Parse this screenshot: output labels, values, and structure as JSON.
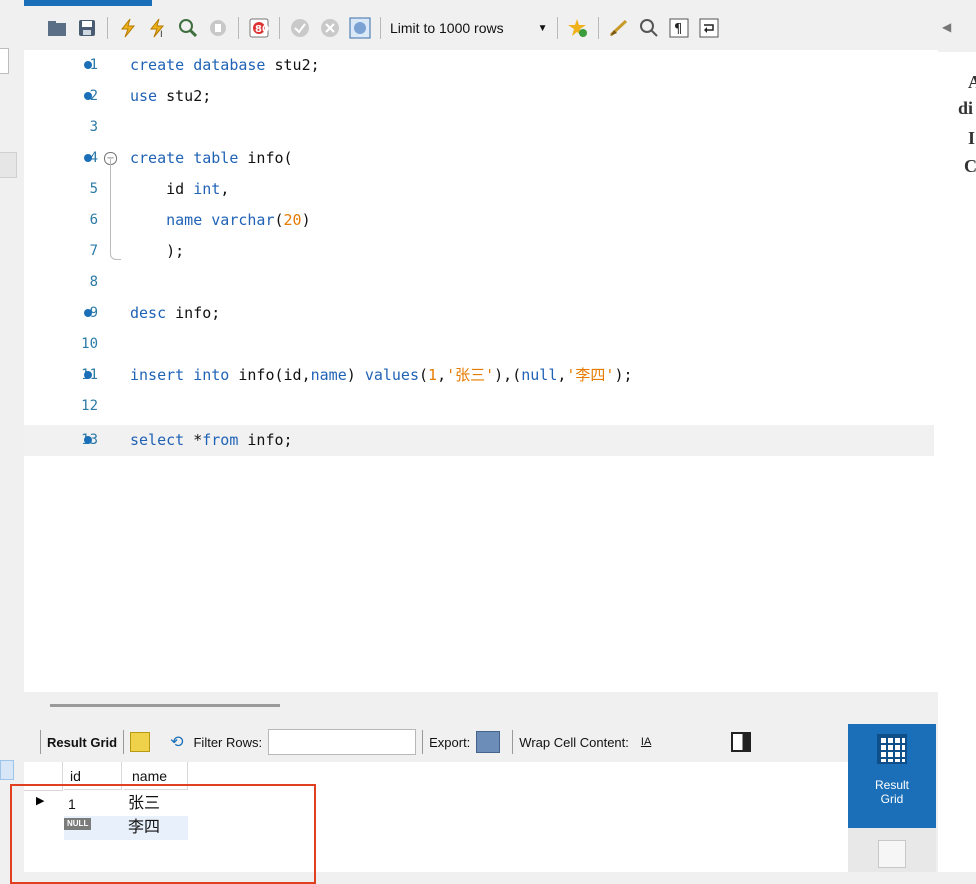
{
  "toolbar": {
    "limit_label": "Limit to 1000 rows",
    "icons": [
      "folder-open-icon",
      "save-icon",
      "execute-icon",
      "execute-current-icon",
      "explain-icon",
      "stop-icon",
      "toggle-error-icon",
      "commit-icon",
      "rollback-icon",
      "autocommit-icon",
      "add-snippet-icon",
      "beautify-icon",
      "find-icon",
      "invisible-chars-icon",
      "wrap-icon"
    ]
  },
  "editor": {
    "lines": [
      {
        "n": "1",
        "code": "create database stu2;"
      },
      {
        "n": "2",
        "code": "use stu2;"
      },
      {
        "n": "3",
        "code": ""
      },
      {
        "n": "4",
        "code": "create table info("
      },
      {
        "n": "5",
        "code": "    id int,"
      },
      {
        "n": "6",
        "code": "    name varchar(20)"
      },
      {
        "n": "7",
        "code": "    );"
      },
      {
        "n": "8",
        "code": ""
      },
      {
        "n": "9",
        "code": "desc info;"
      },
      {
        "n": "10",
        "code": ""
      },
      {
        "n": "11",
        "code": "insert into info(id,name) values(1,'张三'),(null,'李四');"
      },
      {
        "n": "12",
        "code": ""
      },
      {
        "n": "13",
        "code": "select *from info;"
      }
    ]
  },
  "right_panel": {
    "chars": [
      "A",
      "di",
      "I",
      "C"
    ]
  },
  "result": {
    "grid_label": "Result Grid",
    "filter_label": "Filter Rows:",
    "export_label": "Export:",
    "wrap_label": "Wrap Cell Content:",
    "side_tab_label_1": "Result",
    "side_tab_label_2": "Grid",
    "columns": [
      "id",
      "name"
    ],
    "rows": [
      {
        "id": "1",
        "name": "张三"
      },
      {
        "id": "NULL",
        "name": "李四"
      }
    ]
  },
  "colors": {
    "accent": "#1b6fb8",
    "keyword": "#2063b6",
    "literal": "#e77b00",
    "highlight_box": "#e0401f"
  }
}
